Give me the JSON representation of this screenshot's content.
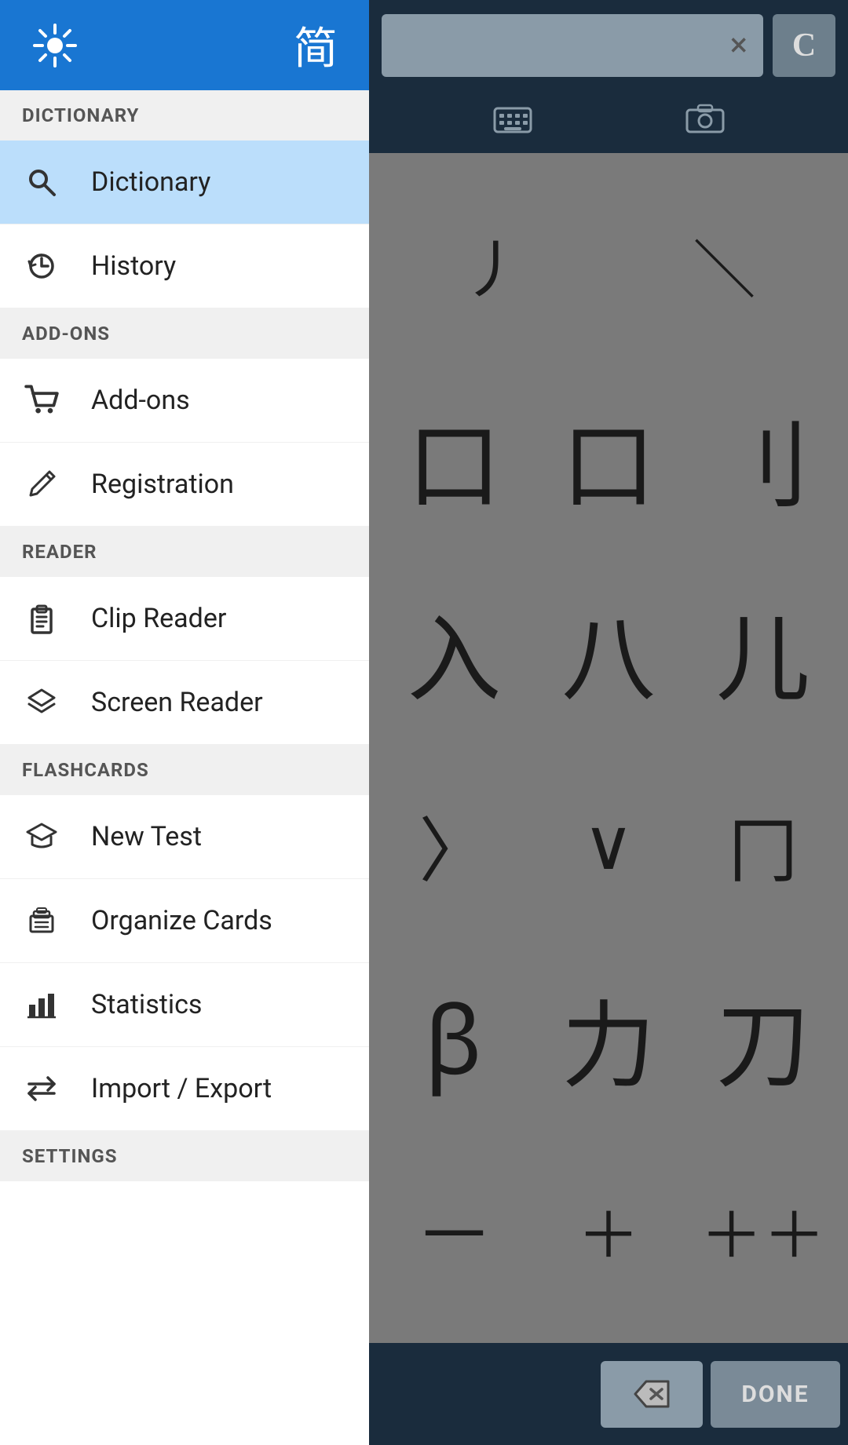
{
  "sidebar": {
    "header": {
      "chinese_char": "简"
    },
    "sections": [
      {
        "id": "dictionary-section",
        "label": "DICTIONARY",
        "items": [
          {
            "id": "dictionary",
            "label": "Dictionary",
            "icon": "search",
            "active": true
          },
          {
            "id": "history",
            "label": "History",
            "icon": "history"
          }
        ]
      },
      {
        "id": "addons-section",
        "label": "ADD-ONS",
        "items": [
          {
            "id": "addons",
            "label": "Add-ons",
            "icon": "cart"
          },
          {
            "id": "registration",
            "label": "Registration",
            "icon": "pen"
          }
        ]
      },
      {
        "id": "reader-section",
        "label": "READER",
        "items": [
          {
            "id": "clip-reader",
            "label": "Clip Reader",
            "icon": "clipboard"
          },
          {
            "id": "screen-reader",
            "label": "Screen Reader",
            "icon": "layers"
          }
        ]
      },
      {
        "id": "flashcards-section",
        "label": "FLASHCARDS",
        "items": [
          {
            "id": "new-test",
            "label": "New Test",
            "icon": "graduation"
          },
          {
            "id": "organize-cards",
            "label": "Organize Cards",
            "icon": "stack"
          },
          {
            "id": "statistics",
            "label": "Statistics",
            "icon": "bar-chart"
          },
          {
            "id": "import-export",
            "label": "Import / Export",
            "icon": "arrows"
          }
        ]
      },
      {
        "id": "settings-section",
        "label": "SETTINGS",
        "items": []
      }
    ]
  },
  "right_panel": {
    "close_label": "×",
    "c_label": "C",
    "done_label": "DONE",
    "chars": [
      [
        "丿",
        "＼"
      ],
      [
        "口",
        "口",
        "刂"
      ],
      [
        "入",
        "八",
        "儿"
      ],
      [
        "乀",
        "∨",
        "冂"
      ],
      [
        "β",
        "力",
        "刀"
      ],
      [
        "一",
        "＋",
        "＋＋"
      ]
    ]
  }
}
